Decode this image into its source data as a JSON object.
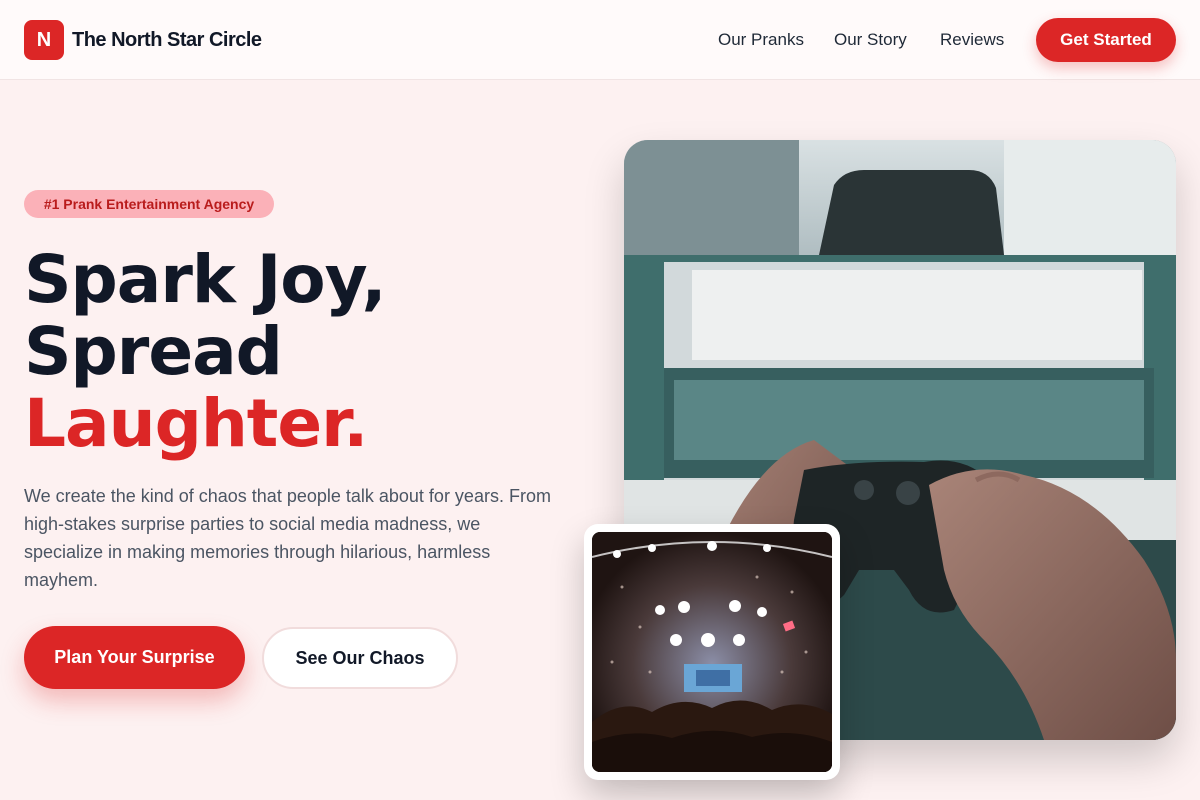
{
  "navbar": {
    "logo_letter": "N",
    "brand_name": "The North Star Circle",
    "links": [
      "Our Pranks",
      "Our Story",
      "Reviews"
    ],
    "cta": "Get Started"
  },
  "hero": {
    "badge": "#1 Prank Entertainment Agency",
    "headline_line1": "Spark Joy,",
    "headline_line2": "Spread",
    "headline_line3": "Laughter.",
    "description": "We create the kind of chaos that people talk about for years. From high-stakes surprise parties to social media madness, we specialize in making memories through hilarious, harmless mayhem.",
    "primary_button": "Plan Your Surprise",
    "secondary_button": "See Our Chaos"
  },
  "images": {
    "main": "game-controller-photo",
    "inset": "concert-crowd-photo"
  },
  "colors": {
    "accent": "#dc2626",
    "background": "#fdf1f1",
    "text": "#111827"
  }
}
